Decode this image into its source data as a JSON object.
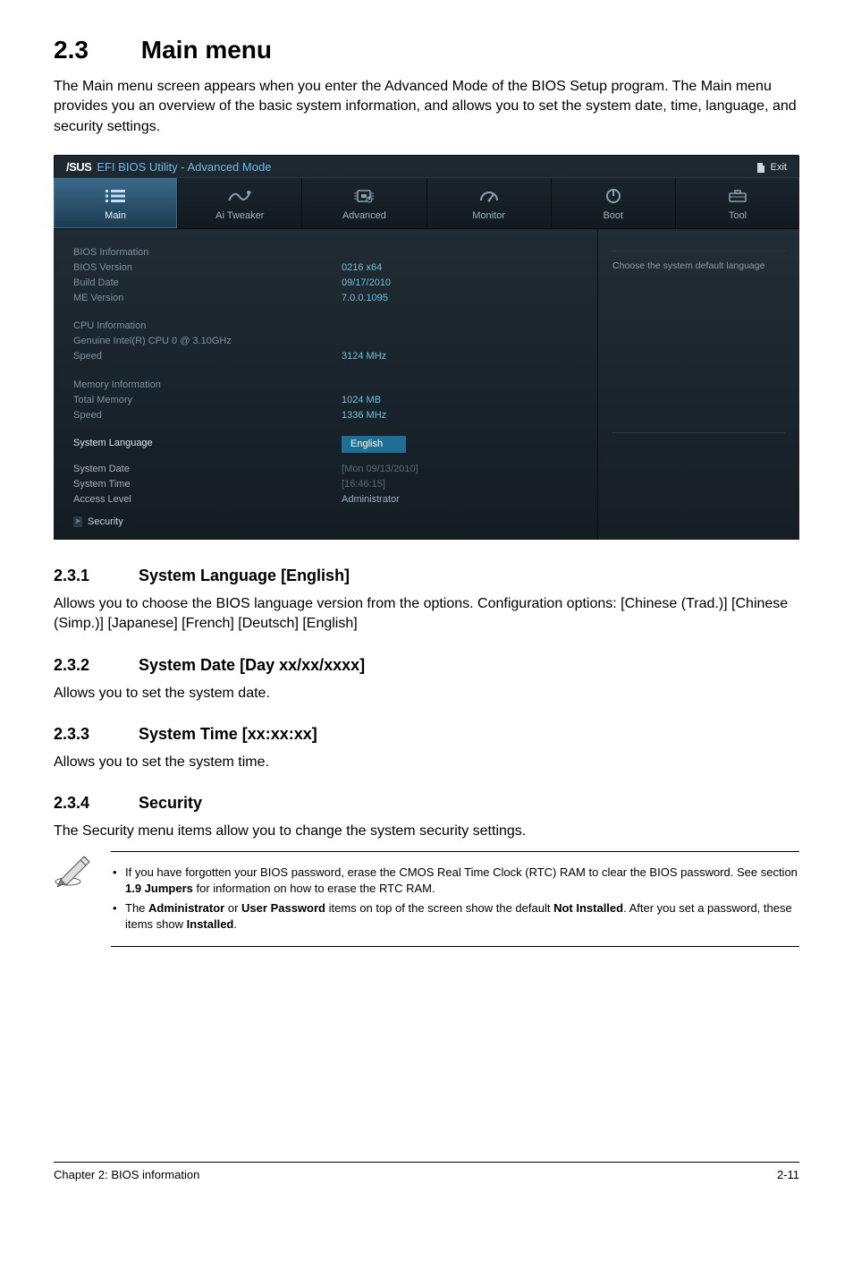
{
  "page": {
    "section_number": "2.3",
    "section_title": "Main menu",
    "intro": "The Main menu screen appears when you enter the Advanced Mode of the BIOS Setup program. The Main menu provides you an overview of the basic system information, and allows you to set the system date, time, language, and security settings."
  },
  "bios": {
    "brand": "/SUS",
    "utility_label": "EFI BIOS Utility - Advanced Mode",
    "exit_label": "Exit",
    "tabs": {
      "main": "Main",
      "ai_tweaker": "Ai Tweaker",
      "advanced": "Advanced",
      "monitor": "Monitor",
      "boot": "Boot",
      "tool": "Tool"
    },
    "right_help": "Choose the system default language",
    "rows": {
      "bios_info_h": "BIOS Information",
      "bios_version_k": "BIOS Version",
      "bios_version_v": "0216 x64",
      "build_date_k": "Build Date",
      "build_date_v": "09/17/2010",
      "me_version_k": "ME Version",
      "me_version_v": "7.0.0.1095",
      "cpu_info_h": "CPU Information",
      "cpu_line": "Genuine Intel(R) CPU 0 @ 3.10GHz",
      "speed_k": "Speed",
      "speed_v": "3124 MHz",
      "mem_info_h": "Memory Information",
      "total_mem_k": "Total Memory",
      "total_mem_v": "1024 MB",
      "mem_speed_k": "Speed",
      "mem_speed_v": "1336 MHz",
      "sys_lang_k": "System Language",
      "sys_lang_v": "English",
      "sys_date_k": "System Date",
      "sys_date_v": "[Mon 09/13/2010]",
      "sys_time_k": "System Time",
      "sys_time_v": "[16:46:15]",
      "access_k": "Access Level",
      "access_v": "Administrator",
      "security": "Security"
    }
  },
  "subsections": {
    "s1_num": "2.3.1",
    "s1_title": "System Language [English]",
    "s1_body": "Allows you to choose the BIOS language version from the options. Configuration options: [Chinese (Trad.)] [Chinese (Simp.)] [Japanese] [French] [Deutsch] [English]",
    "s2_num": "2.3.2",
    "s2_title": "System Date [Day xx/xx/xxxx]",
    "s2_body": "Allows you to set the system date.",
    "s3_num": "2.3.3",
    "s3_title": "System Time [xx:xx:xx]",
    "s3_body": "Allows you to set the system time.",
    "s4_num": "2.3.4",
    "s4_title": "Security",
    "s4_body": "The Security menu items allow you to change the system security settings."
  },
  "notes": {
    "n1_a": "If you have forgotten your BIOS password, erase the CMOS Real Time Clock (RTC) RAM to clear the BIOS password. See section ",
    "n1_b": "1.9 Jumpers",
    "n1_c": " for information on how to erase the RTC RAM.",
    "n2_a": "The ",
    "n2_b": "Administrator",
    "n2_c": " or ",
    "n2_d": "User Password",
    "n2_e": " items on top of the screen show the default ",
    "n2_f": "Not Installed",
    "n2_g": ". After you set a password, these items show ",
    "n2_h": "Installed",
    "n2_i": "."
  },
  "footer": {
    "left": "Chapter 2: BIOS information",
    "right": "2-11"
  }
}
